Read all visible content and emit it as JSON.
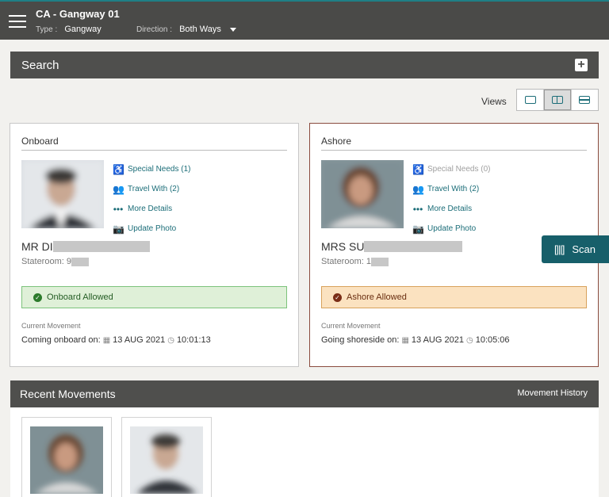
{
  "header": {
    "title": "CA - Gangway 01",
    "type_label": "Type :",
    "type_value": "Gangway",
    "direction_label": "Direction :",
    "direction_value": "Both Ways"
  },
  "search": {
    "label": "Search"
  },
  "views": {
    "label": "Views",
    "options": [
      "single",
      "split",
      "stacked"
    ],
    "selected": "split"
  },
  "onboard": {
    "title": "Onboard",
    "links": {
      "special_needs": "Special Needs (1)",
      "travel_with": "Travel With (2)",
      "more_details": "More Details",
      "update_photo": "Update Photo"
    },
    "name": "MR DI",
    "stateroom": "Stateroom: 9",
    "status": "Onboard Allowed",
    "status_color": "#dff0d8",
    "movement_label": "Current Movement",
    "movement_text": "Coming onboard on:",
    "movement_date": "13 AUG 2021",
    "movement_time": "10:01:13"
  },
  "ashore": {
    "title": "Ashore",
    "links": {
      "special_needs": "Special Needs (0)",
      "travel_with": "Travel With (2)",
      "more_details": "More Details",
      "update_photo": "Update Photo"
    },
    "name": "MRS SU",
    "stateroom": "Stateroom: 1",
    "status": "Ashore Allowed",
    "status_color": "#fbe2c0",
    "movement_label": "Current Movement",
    "movement_text": "Going shoreside on:",
    "movement_date": "13 AUG 2021",
    "movement_time": "10:05:06"
  },
  "scan": {
    "label": "Scan"
  },
  "recent": {
    "title": "Recent Movements",
    "history_link": "Movement History"
  },
  "colors": {
    "accent": "#1b6d78",
    "header_bg": "#4a4a48",
    "ashore_border": "#8a4b3e"
  }
}
